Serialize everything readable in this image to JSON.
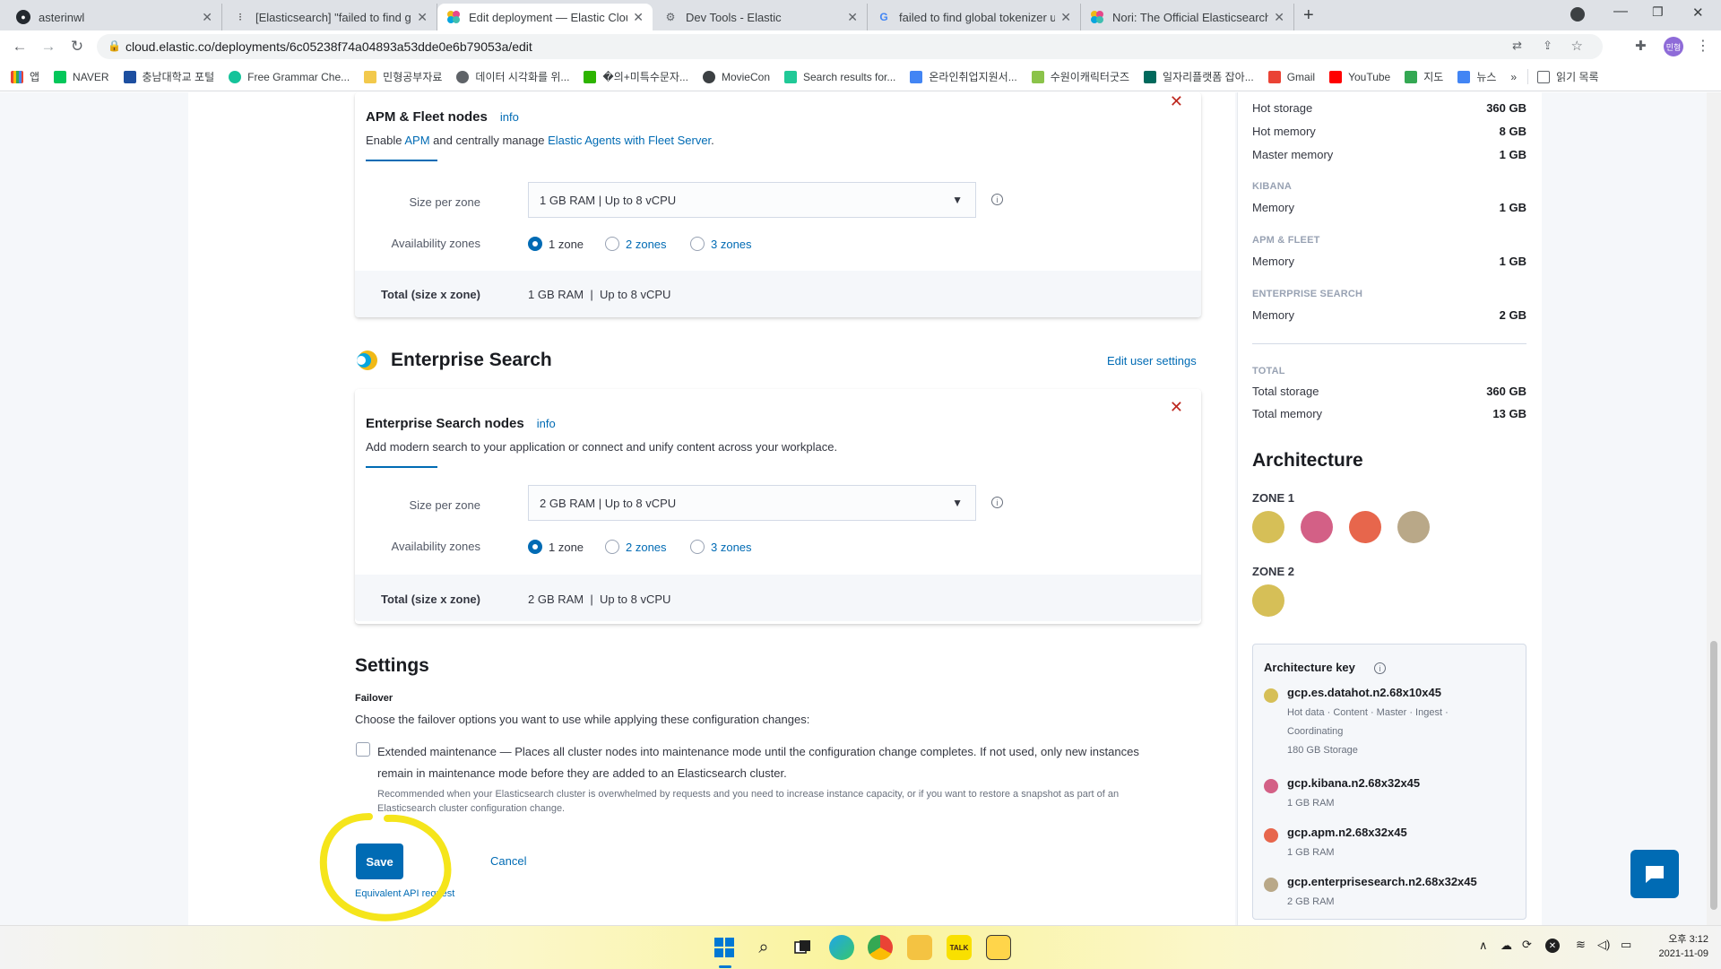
{
  "browser": {
    "tabs": [
      {
        "title": "asterinwl"
      },
      {
        "title": "[Elasticsearch] \"failed to find glo"
      },
      {
        "title": "Edit deployment — Elastic Clou"
      },
      {
        "title": "Dev Tools - Elastic"
      },
      {
        "title": "failed to find global tokenizer u"
      },
      {
        "title": "Nori: The Official Elasticsearch P"
      }
    ],
    "url": "cloud.elastic.co/deployments/6c05238f74a04893a53dde0e6b79053a/edit",
    "bookmarks": [
      "앱",
      "NAVER",
      "충남대학교 포털",
      "Free Grammar Che...",
      "민형공부자료",
      "데이터 시각화를 위...",
      "�의+미특수문자...",
      "MovieCon",
      "Search results for...",
      "온라인취업지원서...",
      "수원이캐릭터굿즈",
      "일자리플랫폼 잡아...",
      "Gmail",
      "YouTube",
      "지도",
      "뉴스"
    ],
    "reading_list": "읽기 목록",
    "profile": "민형"
  },
  "apm": {
    "title": "APM & Fleet nodes",
    "info": "info",
    "desc_pre": "Enable ",
    "desc_link1": "APM",
    "desc_mid": " and centrally manage ",
    "desc_link2": "Elastic Agents with Fleet Server",
    "desc_post": ".",
    "size_label": "Size per zone",
    "size_value": "1 GB RAM | Up to 8 vCPU",
    "zones_label": "Availability zones",
    "zone_options": [
      "1 zone",
      "2 zones",
      "3 zones"
    ],
    "total_label": "Total (size x zone)",
    "total_value": "1 GB RAM  |  Up to 8 vCPU"
  },
  "enterprise": {
    "section_title": "Enterprise Search",
    "edit_settings": "Edit user settings",
    "title": "Enterprise Search nodes",
    "info": "info",
    "desc": "Add modern search to your application or connect and unify content across your workplace.",
    "size_label": "Size per zone",
    "size_value": "2 GB RAM | Up to 8 vCPU",
    "zones_label": "Availability zones",
    "zone_options": [
      "1 zone",
      "2 zones",
      "3 zones"
    ],
    "total_label": "Total (size x zone)",
    "total_value": "2 GB RAM  |  Up to 8 vCPU"
  },
  "settings": {
    "title": "Settings",
    "failover_label": "Failover",
    "failover_desc": "Choose the failover options you want to use while applying these configuration changes:",
    "ext_maint_line1": "Extended maintenance — Places all cluster nodes into maintenance mode until the configuration change completes. If not used, only new instances",
    "ext_maint_line2": "remain in maintenance mode before they are added to an Elasticsearch cluster.",
    "ext_maint_help1": "Recommended when your Elasticsearch cluster is overwhelmed by requests and you need to increase instance capacity, or if you want to restore a snapshot as part of an",
    "ext_maint_help2": "Elasticsearch cluster configuration change.",
    "save": "Save",
    "cancel": "Cancel",
    "api_request": "Equivalent API request"
  },
  "summary": {
    "rows_top": [
      {
        "label": "Hot storage",
        "value": "360 GB"
      },
      {
        "label": "Hot memory",
        "value": "8 GB"
      },
      {
        "label": "Master memory",
        "value": "1 GB"
      }
    ],
    "kibana_head": "KIBANA",
    "kibana_row": {
      "label": "Memory",
      "value": "1 GB"
    },
    "apm_head": "APM & FLEET",
    "apm_row": {
      "label": "Memory",
      "value": "1 GB"
    },
    "es_head": "ENTERPRISE SEARCH",
    "es_row": {
      "label": "Memory",
      "value": "2 GB"
    },
    "total_head": "TOTAL",
    "total_rows": [
      {
        "label": "Total storage",
        "value": "360 GB"
      },
      {
        "label": "Total memory",
        "value": "13 GB"
      }
    ]
  },
  "architecture": {
    "title": "Architecture",
    "zone1": "ZONE 1",
    "zone2": "ZONE 2",
    "key_title": "Architecture key",
    "keys": [
      {
        "name": "gcp.es.datahot.n2.68x10x45",
        "sub1": "Hot data · Content · Master · Ingest ·",
        "sub2": "Coordinating",
        "sub3": "180 GB Storage",
        "color": "#d6bf57"
      },
      {
        "name": "gcp.kibana.n2.68x32x45",
        "sub1": "1 GB RAM",
        "color": "#d36086"
      },
      {
        "name": "gcp.apm.n2.68x32x45",
        "sub1": "1 GB RAM",
        "color": "#e7664c"
      },
      {
        "name": "gcp.enterprisesearch.n2.68x32x45",
        "sub1": "2 GB RAM",
        "color": "#b9a888"
      }
    ]
  },
  "clock": {
    "time": "오후 3:12",
    "date": "2021-11-09"
  }
}
